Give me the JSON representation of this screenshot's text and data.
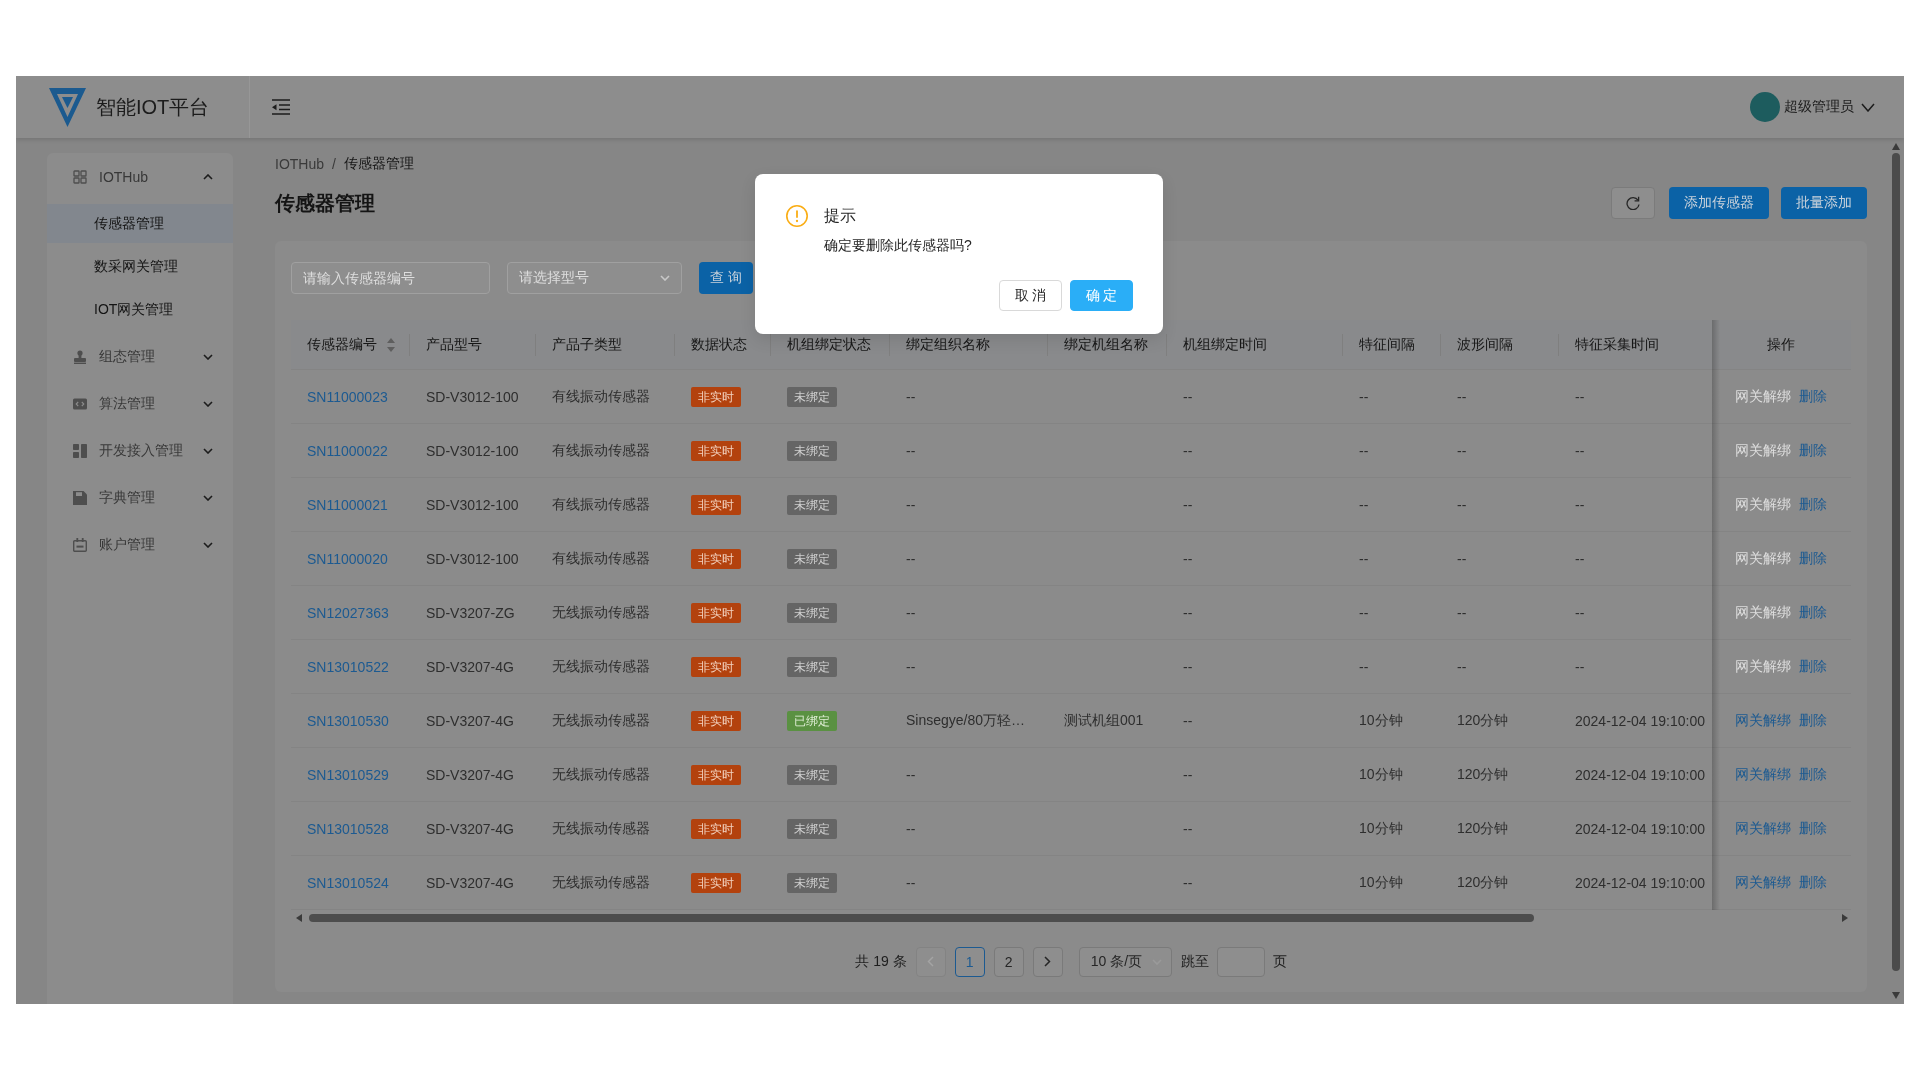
{
  "header": {
    "logo_text": "智能IOT平台",
    "user": "超级管理员"
  },
  "sidebar": {
    "items": [
      {
        "label": "IOTHub",
        "expanded": true,
        "children": [
          {
            "label": "传感器管理",
            "selected": true
          },
          {
            "label": "数采网关管理",
            "selected": false
          },
          {
            "label": "IOT网关管理",
            "selected": false
          }
        ]
      },
      {
        "label": "组态管理",
        "expanded": false
      },
      {
        "label": "算法管理",
        "expanded": false
      },
      {
        "label": "开发接入管理",
        "expanded": false
      },
      {
        "label": "字典管理",
        "expanded": false
      },
      {
        "label": "账户管理",
        "expanded": false
      }
    ]
  },
  "breadcrumb": {
    "items": [
      "IOTHub",
      "传感器管理"
    ],
    "separator": "/"
  },
  "page_title": "传感器管理",
  "toolbar": {
    "buttons": [
      "添加传感器",
      "批量添加"
    ]
  },
  "filters": {
    "search": {
      "placeholder": "请输入传感器编号"
    },
    "model_select": {
      "placeholder": "请选择型号"
    },
    "query_button": "查 询"
  },
  "table": {
    "columns": [
      {
        "label": "传感器编号",
        "sortable": true
      },
      {
        "label": "产品型号",
        "sortable": false
      },
      {
        "label": "产品子类型",
        "sortable": false
      },
      {
        "label": "数据状态",
        "sortable": false
      },
      {
        "label": "机组绑定状态",
        "sortable": false
      },
      {
        "label": "绑定组织名称",
        "sortable": false
      },
      {
        "label": "绑定机组名称",
        "sortable": false
      },
      {
        "label": "机组绑定时间",
        "sortable": false
      },
      {
        "label": "特征间隔",
        "sortable": false
      },
      {
        "label": "波形间隔",
        "sortable": false
      },
      {
        "label": "特征采集时间",
        "sortable": false
      },
      {
        "label": "操作",
        "sortable": false
      }
    ],
    "rows": [
      {
        "sensor_id": "SN11000023",
        "model": "SD-V3012-100",
        "subtype": "有线振动传感器",
        "data_status": {
          "label": "非实时",
          "realtime": false
        },
        "binding": {
          "label": "未绑定",
          "bound": false
        },
        "org": "--",
        "bind_time": "--",
        "feature_interval": "--",
        "wave_interval": "--",
        "collect_time": "--",
        "actions": [
          {
            "label": "网关解绑",
            "disabled": true
          },
          {
            "label": "删除",
            "disabled": false
          }
        ]
      },
      {
        "sensor_id": "SN11000022",
        "model": "SD-V3012-100",
        "subtype": "有线振动传感器",
        "data_status": {
          "label": "非实时",
          "realtime": false
        },
        "binding": {
          "label": "未绑定",
          "bound": false
        },
        "org": "--",
        "bind_time": "--",
        "feature_interval": "--",
        "wave_interval": "--",
        "collect_time": "--",
        "actions": [
          {
            "label": "网关解绑",
            "disabled": true
          },
          {
            "label": "删除",
            "disabled": false
          }
        ]
      },
      {
        "sensor_id": "SN11000021",
        "model": "SD-V3012-100",
        "subtype": "有线振动传感器",
        "data_status": {
          "label": "非实时",
          "realtime": false
        },
        "binding": {
          "label": "未绑定",
          "bound": false
        },
        "org": "--",
        "bind_time": "--",
        "feature_interval": "--",
        "wave_interval": "--",
        "collect_time": "--",
        "actions": [
          {
            "label": "网关解绑",
            "disabled": true
          },
          {
            "label": "删除",
            "disabled": false
          }
        ]
      },
      {
        "sensor_id": "SN11000020",
        "model": "SD-V3012-100",
        "subtype": "有线振动传感器",
        "data_status": {
          "label": "非实时",
          "realtime": false
        },
        "binding": {
          "label": "未绑定",
          "bound": false
        },
        "org": "--",
        "bind_time": "--",
        "feature_interval": "--",
        "wave_interval": "--",
        "collect_time": "--",
        "actions": [
          {
            "label": "网关解绑",
            "disabled": true
          },
          {
            "label": "删除",
            "disabled": false
          }
        ]
      },
      {
        "sensor_id": "SN12027363",
        "model": "SD-V3207-ZG",
        "subtype": "无线振动传感器",
        "data_status": {
          "label": "非实时",
          "realtime": false
        },
        "binding": {
          "label": "未绑定",
          "bound": false
        },
        "org": "--",
        "bind_time": "--",
        "feature_interval": "--",
        "wave_interval": "--",
        "collect_time": "--",
        "actions": [
          {
            "label": "网关解绑",
            "disabled": true
          },
          {
            "label": "删除",
            "disabled": false
          }
        ]
      },
      {
        "sensor_id": "SN13010522",
        "model": "SD-V3207-4G",
        "subtype": "无线振动传感器",
        "data_status": {
          "label": "非实时",
          "realtime": false
        },
        "binding": {
          "label": "未绑定",
          "bound": false
        },
        "org": "--",
        "bind_time": "--",
        "feature_interval": "--",
        "wave_interval": "--",
        "collect_time": "--",
        "actions": [
          {
            "label": "网关解绑",
            "disabled": true
          },
          {
            "label": "删除",
            "disabled": false
          }
        ]
      },
      {
        "sensor_id": "SN13010530",
        "model": "SD-V3207-4G",
        "subtype": "无线振动传感器",
        "data_status": {
          "label": "非实时",
          "realtime": false
        },
        "binding": {
          "label": "已绑定",
          "bound": true
        },
        "org": "Sinsegye/80万轻…",
        "unit": "测试机组001",
        "bind_time": "--",
        "feature_interval": "10分钟",
        "wave_interval": "120分钟",
        "collect_time": "2024-12-04 19:10:00",
        "actions": [
          {
            "label": "网关解绑",
            "disabled": false
          },
          {
            "label": "删除",
            "disabled": false
          }
        ]
      },
      {
        "sensor_id": "SN13010529",
        "model": "SD-V3207-4G",
        "subtype": "无线振动传感器",
        "data_status": {
          "label": "非实时",
          "realtime": false
        },
        "binding": {
          "label": "未绑定",
          "bound": false
        },
        "org": "--",
        "bind_time": "--",
        "feature_interval": "10分钟",
        "wave_interval": "120分钟",
        "collect_time": "2024-12-04 19:10:00",
        "actions": [
          {
            "label": "网关解绑",
            "disabled": false
          },
          {
            "label": "删除",
            "disabled": false
          }
        ]
      },
      {
        "sensor_id": "SN13010528",
        "model": "SD-V3207-4G",
        "subtype": "无线振动传感器",
        "data_status": {
          "label": "非实时",
          "realtime": false
        },
        "binding": {
          "label": "未绑定",
          "bound": false
        },
        "org": "--",
        "bind_time": "--",
        "feature_interval": "10分钟",
        "wave_interval": "120分钟",
        "collect_time": "2024-12-04 19:10:00",
        "actions": [
          {
            "label": "网关解绑",
            "disabled": false
          },
          {
            "label": "删除",
            "disabled": false
          }
        ]
      },
      {
        "sensor_id": "SN13010524",
        "model": "SD-V3207-4G",
        "subtype": "无线振动传感器",
        "data_status": {
          "label": "非实时",
          "realtime": false
        },
        "binding": {
          "label": "未绑定",
          "bound": false
        },
        "org": "--",
        "bind_time": "--",
        "feature_interval": "10分钟",
        "wave_interval": "120分钟",
        "collect_time": "2024-12-04 19:10:00",
        "actions": [
          {
            "label": "网关解绑",
            "disabled": false
          },
          {
            "label": "删除",
            "disabled": false
          }
        ]
      }
    ]
  },
  "pagination": {
    "total": "共 19 条",
    "prev": {
      "disabled": true
    },
    "pages": [
      {
        "label": "1",
        "selected": true
      },
      {
        "label": "2",
        "selected": false
      }
    ],
    "next": {
      "disabled": false
    },
    "page_size": "10 条/页",
    "jump_label": "跳至",
    "jump_suffix": "页"
  },
  "dialog": {
    "title": "提示",
    "message": "确定要删除此传感器吗?",
    "buttons": [
      {
        "label": "取 消",
        "kind": "default"
      },
      {
        "label": "确 定",
        "kind": "primary"
      }
    ]
  }
}
